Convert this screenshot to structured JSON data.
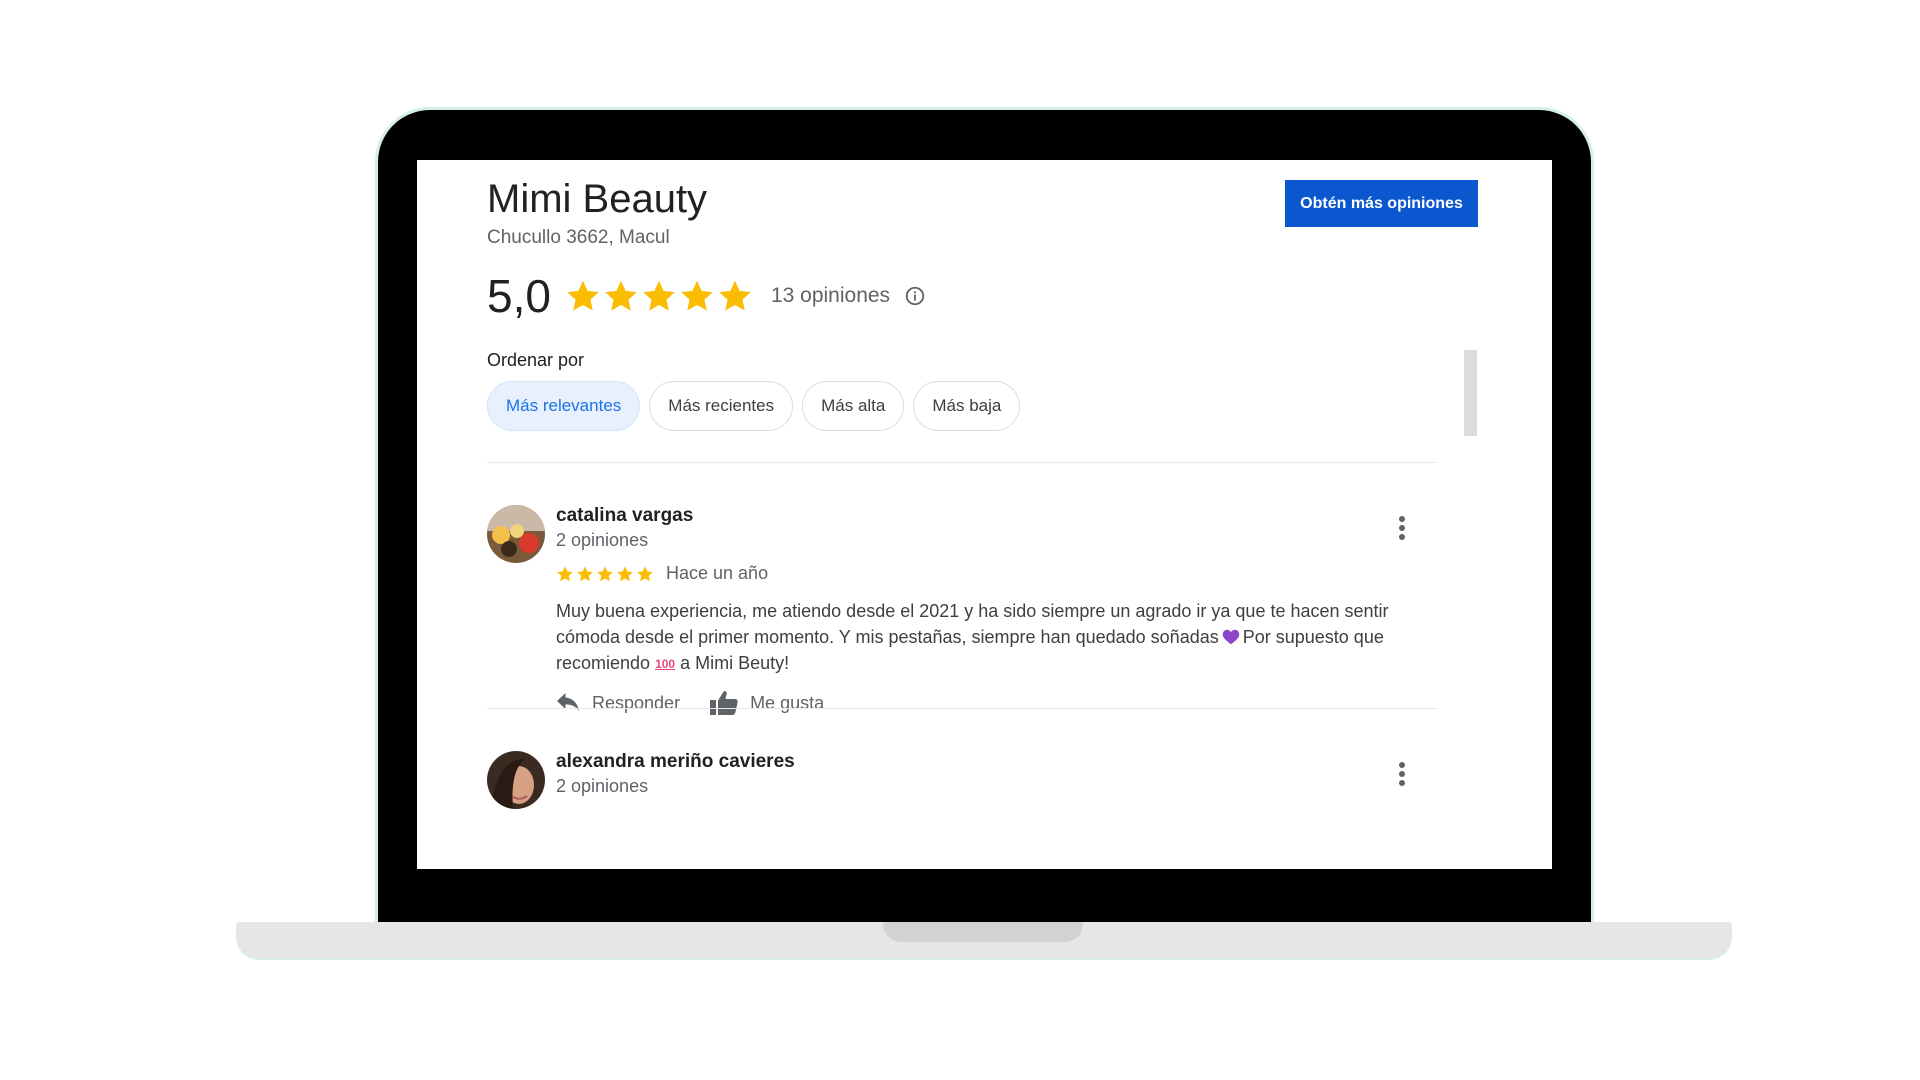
{
  "business": {
    "name": "Mimi Beauty",
    "address": "Chucullo 3662, Macul",
    "cta_label": "Obtén más opiniones",
    "rating": "5,0",
    "rating_value": 5,
    "reviews_count": "13 opiniones",
    "star_color": "#fbbc04"
  },
  "sort": {
    "label": "Ordenar por",
    "options": [
      "Más relevantes",
      "Más recientes",
      "Más alta",
      "Más baja"
    ],
    "selected": "Más relevantes"
  },
  "reviews": [
    {
      "author": "catalina vargas",
      "author_reviews": "2 opiniones",
      "stars": 5,
      "date": "Hace un año",
      "text_part1": "Muy buena experiencia, me atiendo desde el 2021 y ha sido siempre un agrado ir ya que te hacen sentir cómoda desde el primer momento. Y mis pestañas, siempre han quedado soñadas",
      "text_part2": "Por supuesto que recomiendo",
      "text_part3": "a Mimi Beuty!",
      "emoji_heart": "purple-heart-icon",
      "emoji_hundred": "100",
      "reply_label": "Responder",
      "like_label": "Me gusta"
    },
    {
      "author": "alexandra meriño cavieres",
      "author_reviews": "2 opiniones"
    }
  ],
  "icons": [
    "star-icon",
    "info-icon",
    "more-vert-icon",
    "reply-icon",
    "thumb-up-icon",
    "avatar"
  ]
}
